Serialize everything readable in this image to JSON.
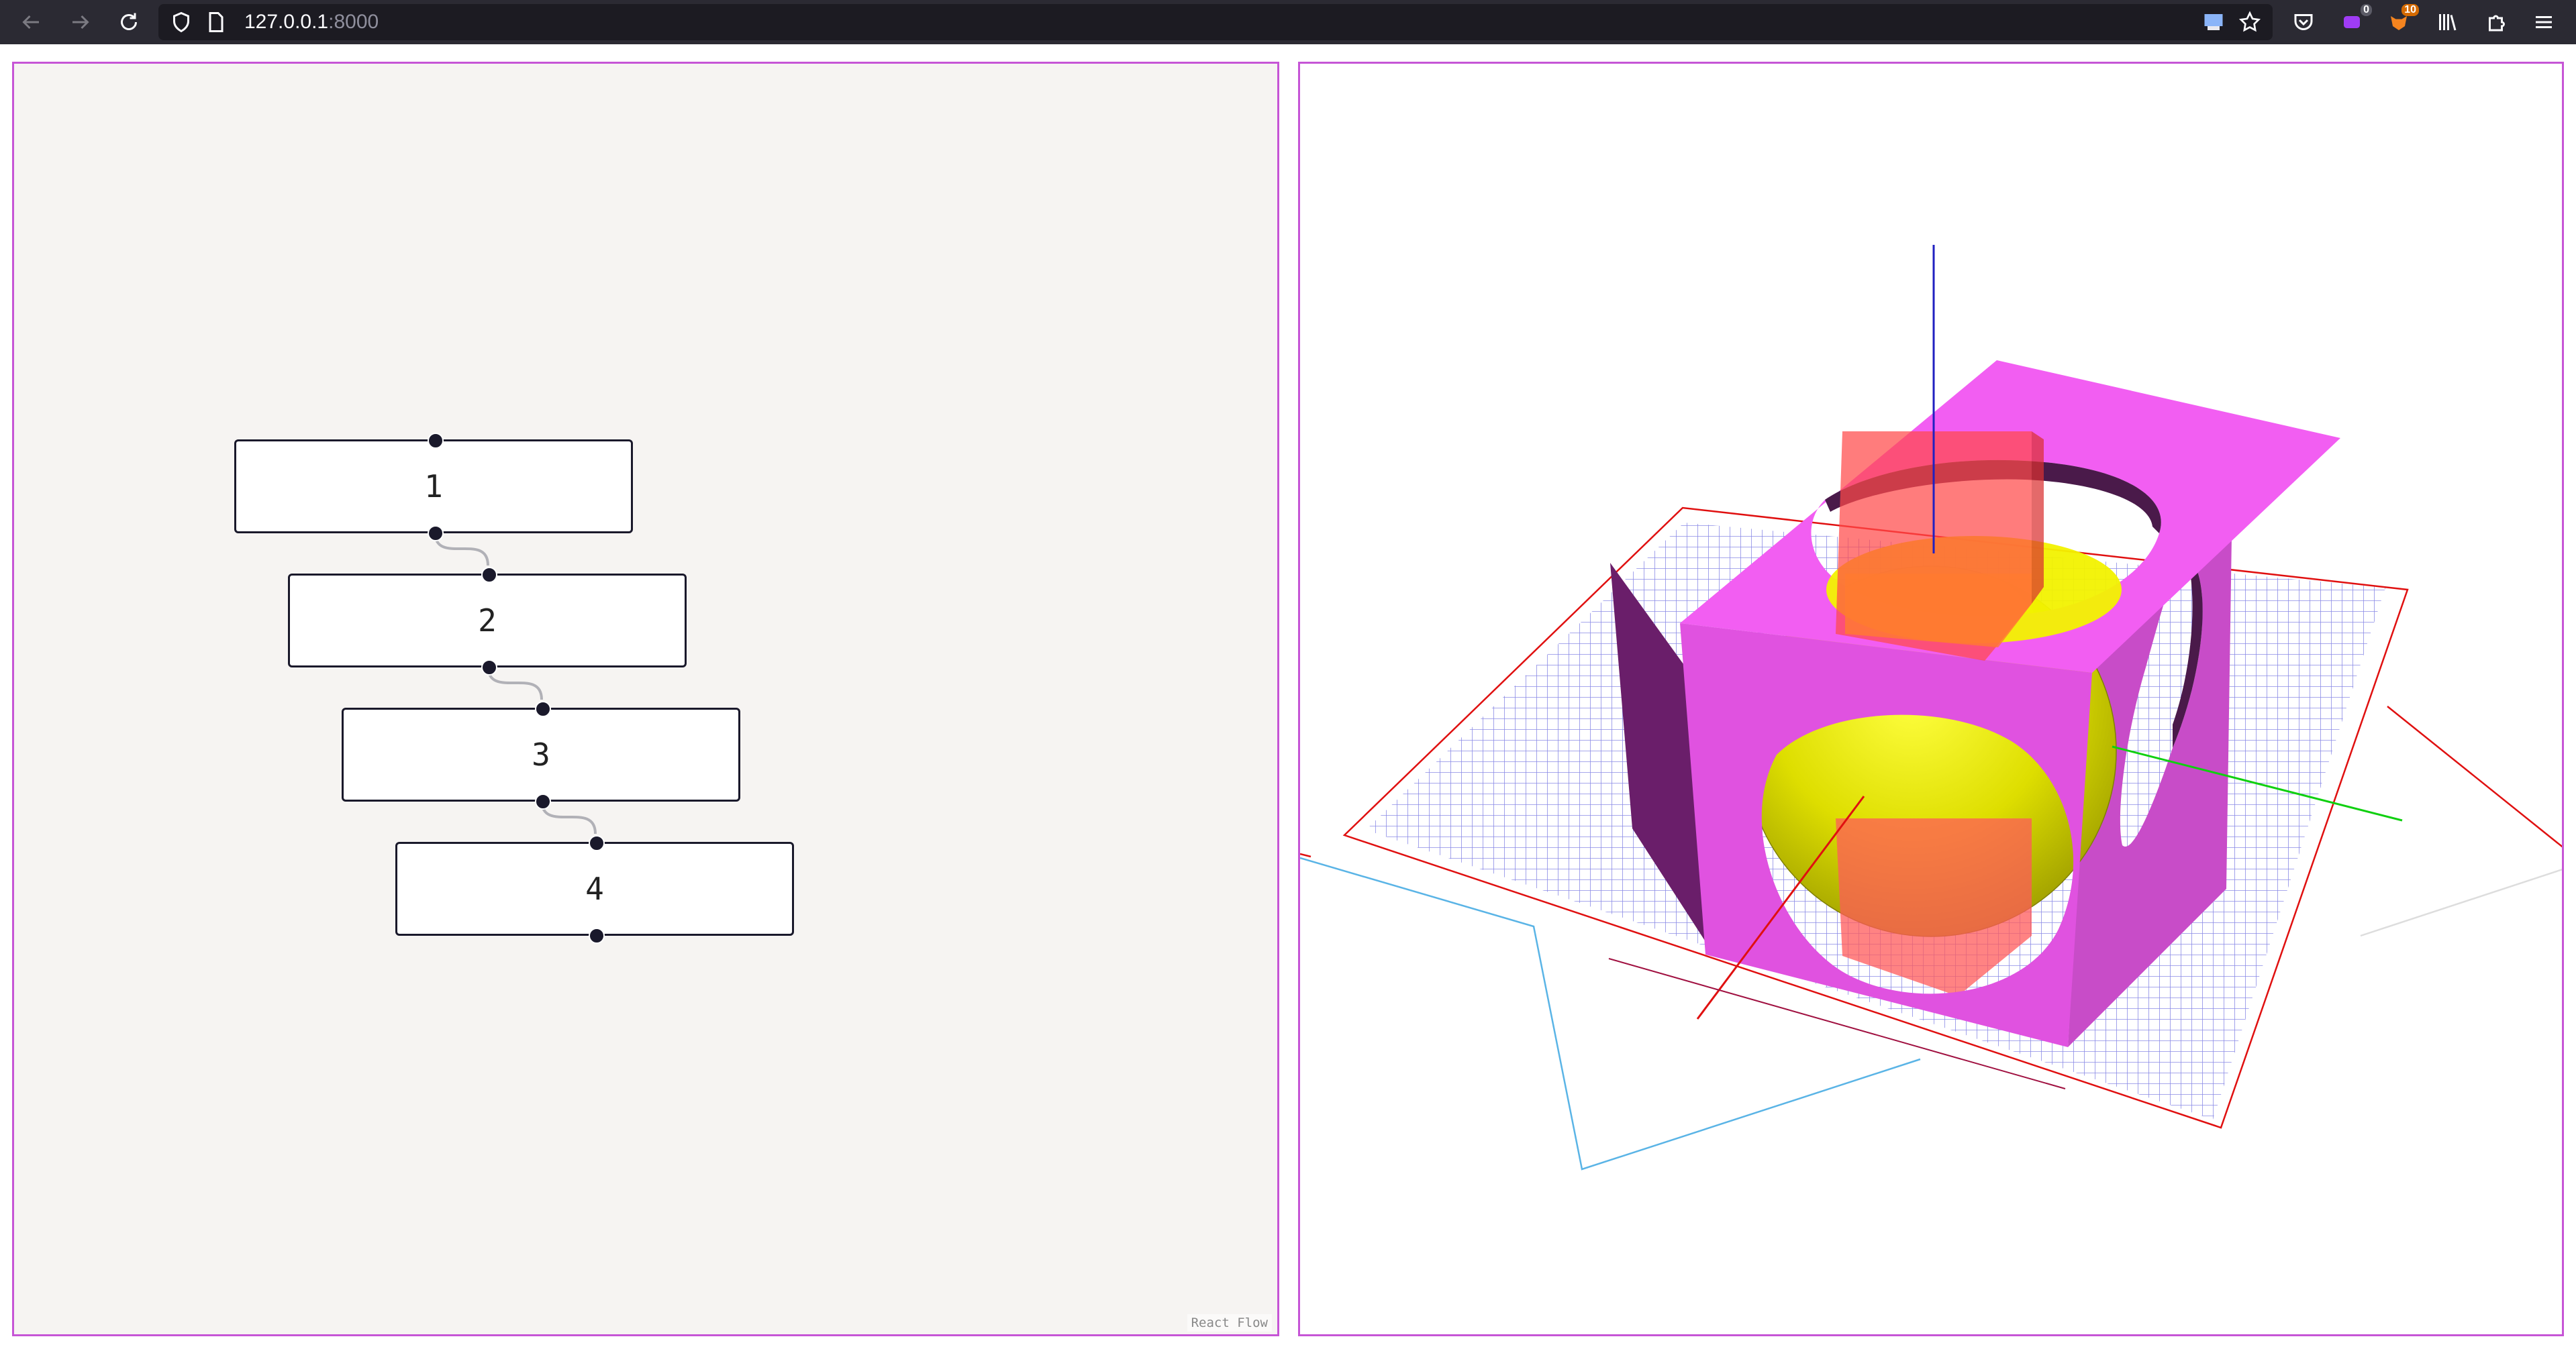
{
  "browser": {
    "url_host": "127.0.0.1",
    "url_port": ":8000",
    "extension_badges": [
      "0",
      "10"
    ]
  },
  "flow_editor": {
    "nodes": [
      {
        "label": "1"
      },
      {
        "label": "2"
      },
      {
        "label": "3"
      },
      {
        "label": "4"
      }
    ],
    "attribution": "React Flow"
  },
  "viewer": {
    "colors": {
      "frame": "#f25ef2",
      "sphere": "#f2f200",
      "box": "#ff4040",
      "grid": "#8a8ae6",
      "x_axis": "#e01010",
      "y_axis": "#10d010",
      "z_axis": "#2020c0"
    }
  },
  "colors": {
    "panel_border": "#c655d6",
    "toolbar_bg": "#2b2a33",
    "flow_bg": "#f6f4f2"
  }
}
